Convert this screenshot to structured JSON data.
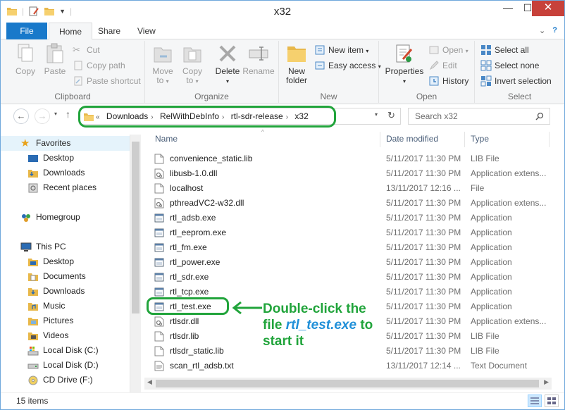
{
  "window": {
    "title": "x32"
  },
  "ribbon_tabs": [
    "File",
    "Home",
    "Share",
    "View"
  ],
  "ribbon": {
    "clipboard": {
      "label": "Clipboard",
      "copy": "Copy",
      "paste": "Paste",
      "cut": "Cut",
      "copy_path": "Copy path",
      "paste_shortcut": "Paste shortcut"
    },
    "organize": {
      "label": "Organize",
      "move_to": "Move",
      "move_to2": "to",
      "copy_to": "Copy",
      "copy_to2": "to",
      "delete": "Delete",
      "rename": "Rename"
    },
    "new": {
      "label": "New",
      "new_folder": "New",
      "new_folder2": "folder",
      "new_item": "New item",
      "easy_access": "Easy access"
    },
    "open": {
      "label": "Open",
      "properties": "Properties",
      "open": "Open",
      "edit": "Edit",
      "history": "History"
    },
    "select": {
      "label": "Select",
      "select_all": "Select all",
      "select_none": "Select none",
      "invert_selection": "Invert selection"
    }
  },
  "address": {
    "prefix": "«",
    "crumbs": [
      "Downloads",
      "RelWithDebInfo",
      "rtl-sdr-release",
      "x32"
    ]
  },
  "search": {
    "placeholder": "Search x32"
  },
  "nav": {
    "favorites": "Favorites",
    "fav_items": [
      "Desktop",
      "Downloads",
      "Recent places"
    ],
    "homegroup": "Homegroup",
    "thispc": "This PC",
    "pc_items": [
      "Desktop",
      "Documents",
      "Downloads",
      "Music",
      "Pictures",
      "Videos",
      "Local Disk (C:)",
      "Local Disk (D:)",
      "CD Drive (F:)"
    ]
  },
  "columns": {
    "name": "Name",
    "date": "Date modified",
    "type": "Type"
  },
  "files": [
    {
      "name": "convenience_static.lib",
      "date": "5/11/2017 11:30 PM",
      "type": "LIB File",
      "icon": "file"
    },
    {
      "name": "libusb-1.0.dll",
      "date": "5/11/2017 11:30 PM",
      "type": "Application extens...",
      "icon": "dll"
    },
    {
      "name": "localhost",
      "date": "13/11/2017 12:16 ...",
      "type": "File",
      "icon": "file"
    },
    {
      "name": "pthreadVC2-w32.dll",
      "date": "5/11/2017 11:30 PM",
      "type": "Application extens...",
      "icon": "dll"
    },
    {
      "name": "rtl_adsb.exe",
      "date": "5/11/2017 11:30 PM",
      "type": "Application",
      "icon": "exe"
    },
    {
      "name": "rtl_eeprom.exe",
      "date": "5/11/2017 11:30 PM",
      "type": "Application",
      "icon": "exe"
    },
    {
      "name": "rtl_fm.exe",
      "date": "5/11/2017 11:30 PM",
      "type": "Application",
      "icon": "exe"
    },
    {
      "name": "rtl_power.exe",
      "date": "5/11/2017 11:30 PM",
      "type": "Application",
      "icon": "exe"
    },
    {
      "name": "rtl_sdr.exe",
      "date": "5/11/2017 11:30 PM",
      "type": "Application",
      "icon": "exe"
    },
    {
      "name": "rtl_tcp.exe",
      "date": "5/11/2017 11:30 PM",
      "type": "Application",
      "icon": "exe"
    },
    {
      "name": "rtl_test.exe",
      "date": "5/11/2017 11:30 PM",
      "type": "Application",
      "icon": "exe"
    },
    {
      "name": "rtlsdr.dll",
      "date": "5/11/2017 11:30 PM",
      "type": "Application extens...",
      "icon": "dll"
    },
    {
      "name": "rtlsdr.lib",
      "date": "5/11/2017 11:30 PM",
      "type": "LIB File",
      "icon": "file"
    },
    {
      "name": "rtlsdr_static.lib",
      "date": "5/11/2017 11:30 PM",
      "type": "LIB File",
      "icon": "file"
    },
    {
      "name": "scan_rtl_adsb.txt",
      "date": "13/11/2017 12:14 ...",
      "type": "Text Document",
      "icon": "txt"
    }
  ],
  "status": {
    "count": "15 items"
  },
  "annotation": {
    "line1": "Double-click the",
    "line2a": "file ",
    "line2b": "rtl_test.exe",
    "line2c": " to",
    "line3": "start it"
  },
  "colors": {
    "highlight_green": "#21a43b",
    "file_tab_blue": "#1979ca",
    "annotation_blue": "#1f8fd8"
  }
}
